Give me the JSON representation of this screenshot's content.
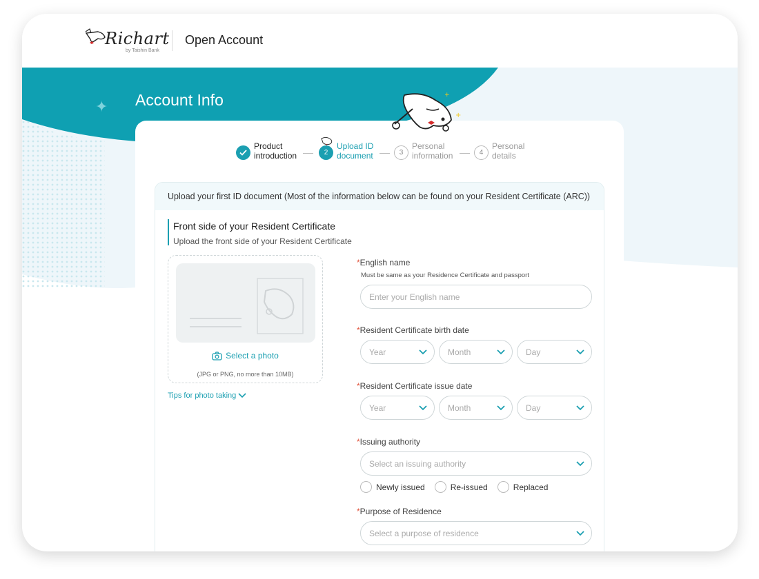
{
  "header": {
    "logo_text": "Richart",
    "logo_sub": "by Taishin Bank",
    "title": "Open Account"
  },
  "hero": {
    "title": "Account Info"
  },
  "steps": [
    {
      "number": "1",
      "label": "Product introduction",
      "state": "done"
    },
    {
      "number": "2",
      "label": "Upload ID document",
      "state": "active"
    },
    {
      "number": "3",
      "label": "Personal information",
      "state": "todo"
    },
    {
      "number": "4",
      "label": "Personal details",
      "state": "todo"
    }
  ],
  "panel": {
    "heading": "Upload your first ID document (Most of the information below can be found on your Resident Certificate (ARC))",
    "section_title": "Front side of your Resident Certificate",
    "section_subtitle": "Upload the front side of your Resident Certificate"
  },
  "upload": {
    "select_label": "Select a photo",
    "note": "(JPG or PNG, no more than 10MB)",
    "tips_label": "Tips for photo taking"
  },
  "form": {
    "required_mark": "*",
    "english_name": {
      "label": "English name",
      "hint": "Must be same as your Residence Certificate and passport",
      "placeholder": "Enter your English name",
      "value": ""
    },
    "birth_date": {
      "label": "Resident Certificate birth date",
      "year": "Year",
      "month": "Month",
      "day": "Day"
    },
    "issue_date": {
      "label": "Resident Certificate issue date",
      "year": "Year",
      "month": "Month",
      "day": "Day"
    },
    "issuing_authority": {
      "label": "Issuing authority",
      "placeholder": "Select an issuing authority",
      "options": [
        "Newly issued",
        "Re-issued",
        "Replaced"
      ]
    },
    "purpose": {
      "label": "Purpose of Residence",
      "placeholder": "Select a purpose of residence"
    }
  },
  "colors": {
    "accent": "#1b9fb1",
    "required": "#e0533b",
    "hero_band": "#0fa0b2",
    "panel_head_bg": "#f1f9fb"
  }
}
